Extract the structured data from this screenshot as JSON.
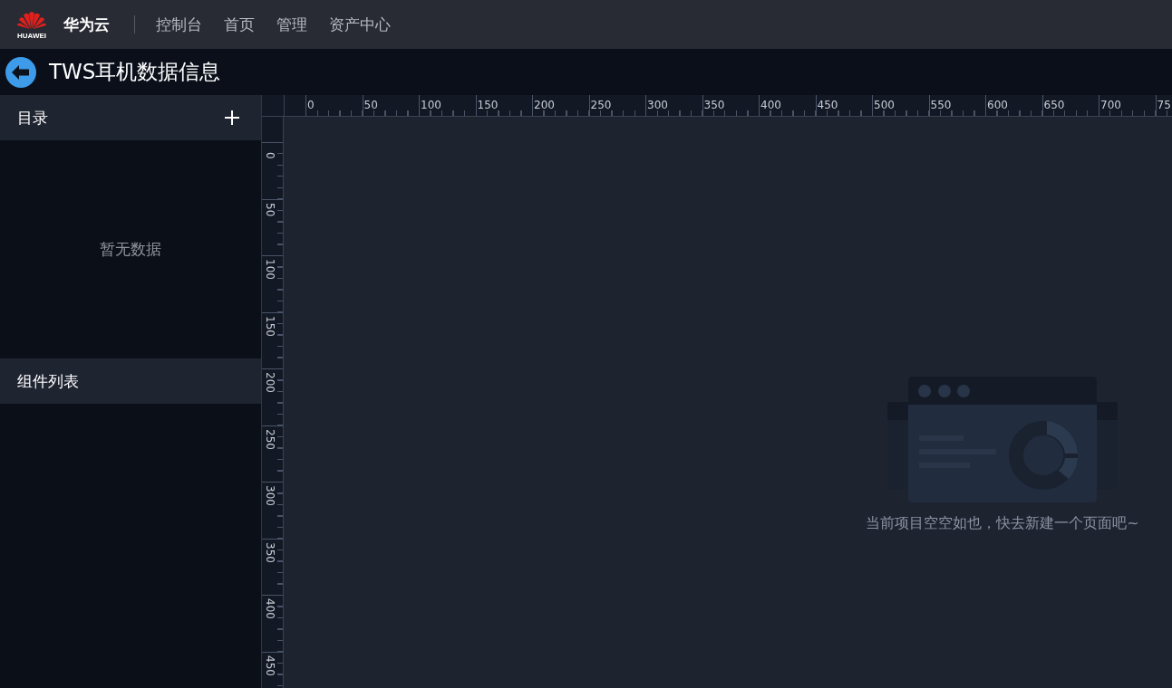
{
  "topbar": {
    "logo_text": "HUAWEI",
    "brand": "华为云",
    "nav": [
      {
        "label": "控制台"
      },
      {
        "label": "首页"
      },
      {
        "label": "管理"
      },
      {
        "label": "资产中心"
      }
    ]
  },
  "header": {
    "title": "TWS耳机数据信息"
  },
  "sidebar": {
    "sections": [
      {
        "title": "目录",
        "empty_text": "暂无数据"
      },
      {
        "title": "组件列表"
      }
    ]
  },
  "ruler": {
    "x_labels": [
      "0",
      "50",
      "100",
      "150",
      "200",
      "250",
      "300",
      "350",
      "400",
      "450",
      "500",
      "550",
      "600",
      "650",
      "700",
      "75"
    ],
    "y_labels": [
      "0",
      "50",
      "100",
      "150",
      "200",
      "250",
      "300",
      "350",
      "400",
      "450"
    ]
  },
  "canvas": {
    "empty_text": "当前项目空空如也，快去新建一个页面吧~"
  }
}
